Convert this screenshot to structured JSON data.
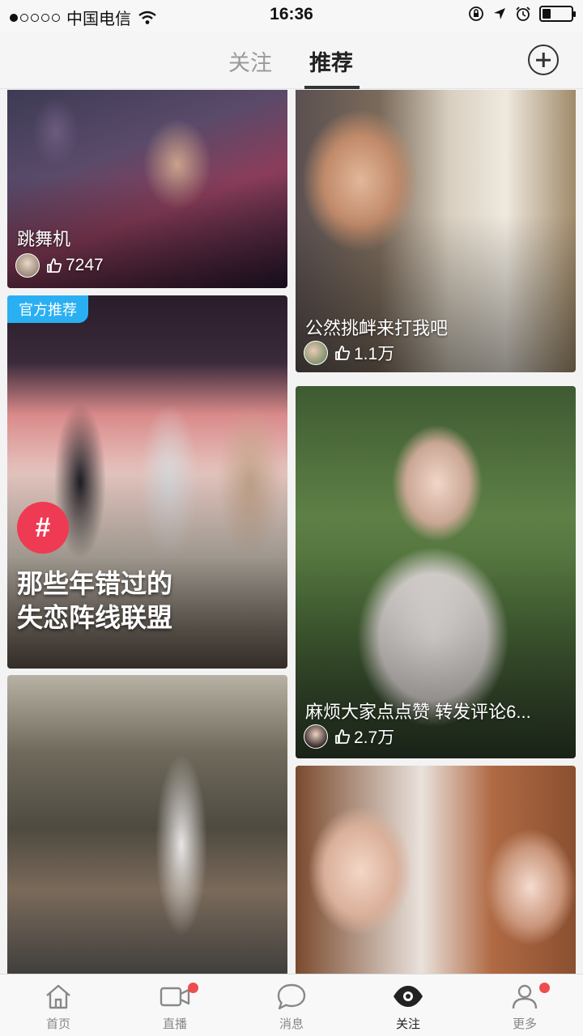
{
  "status_bar": {
    "carrier": "中国电信",
    "time": "16:36"
  },
  "top_nav": {
    "tabs": [
      {
        "label": "关注",
        "active": false
      },
      {
        "label": "推荐",
        "active": true
      }
    ],
    "add_icon": "plus-circle-icon"
  },
  "feed": {
    "cards": [
      {
        "title": "跳舞机",
        "likes": "7247"
      },
      {
        "title": "公然挑衅来打我吧",
        "likes": "1.1万"
      },
      {
        "badge": "官方推荐",
        "topic_line1": "那些年错过的",
        "topic_line2": "失恋阵线联盟",
        "hash_symbol": "#"
      },
      {
        "title": "麻烦大家点点赞 转发评论6...",
        "likes": "2.7万"
      },
      {},
      {}
    ]
  },
  "tab_bar": {
    "items": [
      {
        "label": "首页",
        "icon": "home-icon"
      },
      {
        "label": "直播",
        "icon": "video-camera-icon",
        "notification_dot": true
      },
      {
        "label": "消息",
        "icon": "chat-bubble-icon"
      },
      {
        "label": "关注",
        "icon": "eye-icon",
        "active": true
      },
      {
        "label": "更多",
        "icon": "profile-icon",
        "notification_dot": true
      }
    ]
  },
  "colors": {
    "badge_blue": "#2ab0f2",
    "hashtag_red": "#ef3a54",
    "notification_red": "#ef4d4d"
  }
}
